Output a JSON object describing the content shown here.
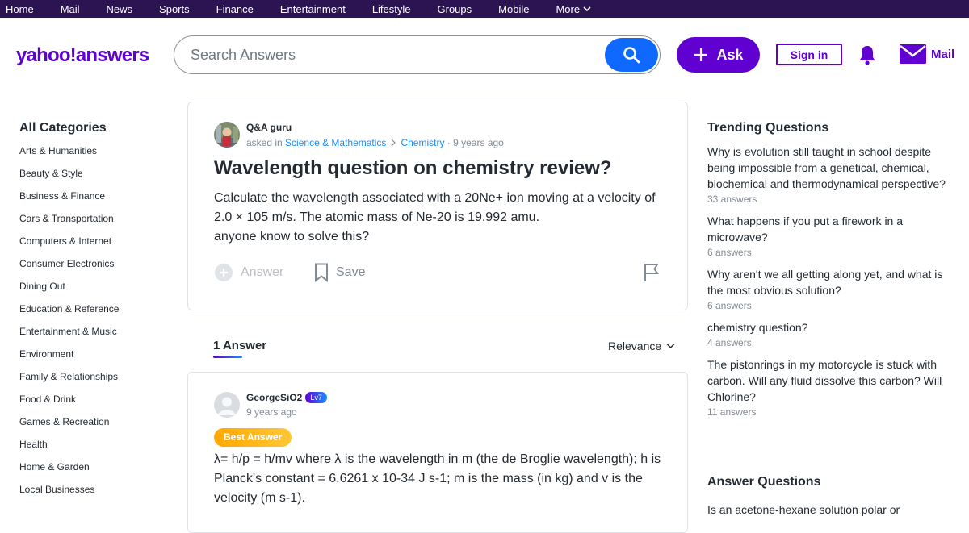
{
  "topnav": {
    "items": [
      "Home",
      "Mail",
      "News",
      "Sports",
      "Finance",
      "Entertainment",
      "Lifestyle",
      "Groups",
      "Mobile"
    ],
    "more_label": "More"
  },
  "header": {
    "logo_text": "yahoo!answers",
    "search_placeholder": "Search Answers",
    "ask_label": "Ask",
    "signin_label": "Sign in",
    "mail_label": "Mail",
    "brand_color": "#6001d2",
    "accent_color": "#0f69ff"
  },
  "sidebar": {
    "title": "All Categories",
    "categories": [
      "Arts & Humanities",
      "Beauty & Style",
      "Business & Finance",
      "Cars & Transportation",
      "Computers & Internet",
      "Consumer Electronics",
      "Dining Out",
      "Education & Reference",
      "Entertainment & Music",
      "Environment",
      "Family & Relationships",
      "Food & Drink",
      "Games & Recreation",
      "Health",
      "Home & Garden",
      "Local Businesses"
    ]
  },
  "question": {
    "author": "Q&A guru",
    "asked_in_label": "asked in",
    "category": "Science & Mathematics",
    "subcategory": "Chemistry",
    "time_ago": "· 9 years ago",
    "title": "Wavelength question on chemistry review?",
    "body_lines": [
      "Calculate the wavelength associated with a 20Ne+ ion moving at a velocity of 2.0 × 105 m/s. The atomic mass of Ne-20 is 19.992 amu.",
      "anyone know to solve this?"
    ],
    "answer_label": "Answer",
    "save_label": "Save"
  },
  "answers": {
    "count_label": "1 Answer",
    "sort_label": "Relevance",
    "items": [
      {
        "author": "GeorgeSiO2",
        "level": "Lv7",
        "time_ago": "9 years ago",
        "best_label": "Best Answer",
        "body": "λ= h/p = h/mv where λ is the wavelength in m (the de Broglie wavelength); h is Planck's constant = 6.6261 x 10-34 J s-1; m is the mass (in kg) and v is the velocity (m s-1)."
      }
    ]
  },
  "trending": {
    "title": "Trending Questions",
    "items": [
      {
        "question": "Why is evolution still taught in school despite being impossible from a genetical, chemical, biochemical and thermodynamical perspective?",
        "answers": "33 answers"
      },
      {
        "question": "What happens if you put a firework in a microwave?",
        "answers": "6 answers"
      },
      {
        "question": "Why aren't we all getting along yet, and what is the most obvious solution?",
        "answers": "6 answers"
      },
      {
        "question": "chemistry question?",
        "answers": "4 answers"
      },
      {
        "question": "The pistonrings in my motorcycle is stuck with carbon. Will any fluid dissolve this carbon? Will Chlorine?",
        "answers": "11 answers"
      }
    ]
  },
  "answer_questions": {
    "title": "Answer Questions",
    "first_item": "Is an acetone-hexane solution polar or"
  }
}
